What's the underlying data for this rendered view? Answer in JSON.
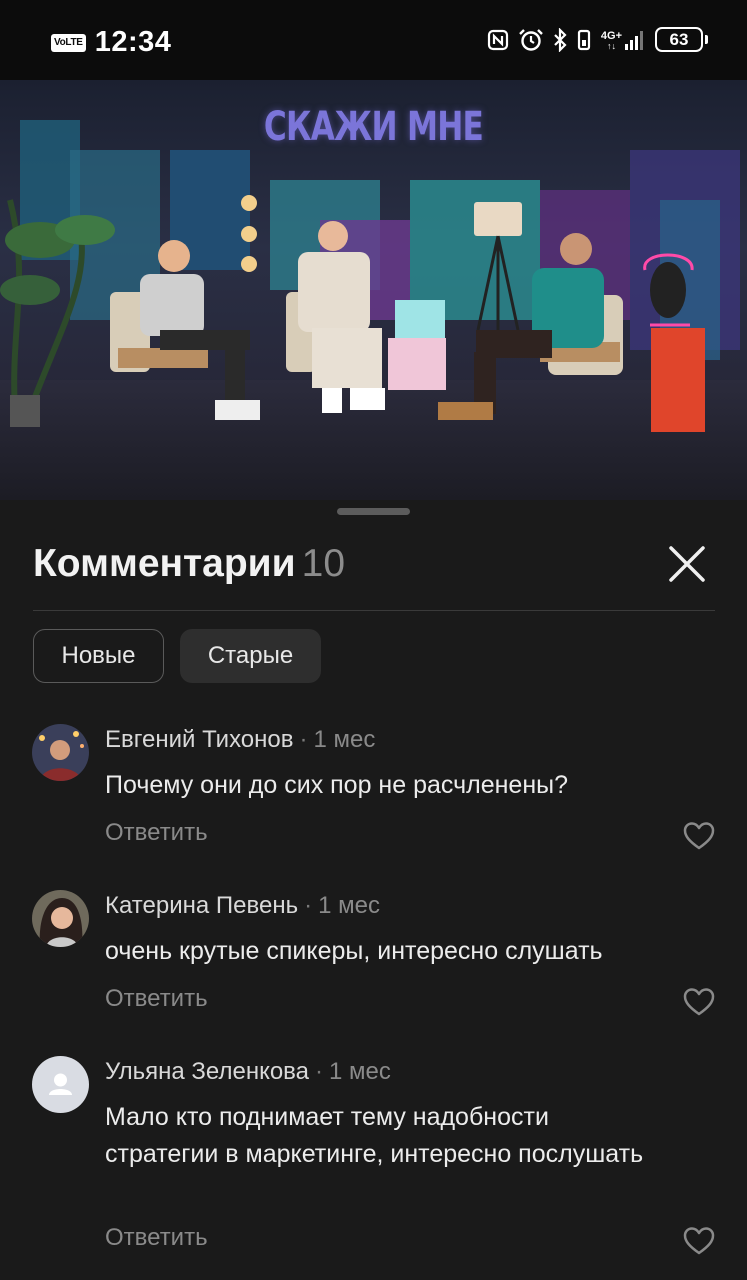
{
  "status_bar": {
    "volte": "VoLTE",
    "time": "12:34",
    "network_top": "4G+",
    "network_bottom": "↑↓",
    "battery": "63"
  },
  "video": {
    "title_overlay": "СКАЖИ МНЕ"
  },
  "comments_sheet": {
    "title": "Комментарии",
    "count": "10",
    "sort": {
      "new_label": "Новые",
      "old_label": "Старые",
      "selected": "old"
    },
    "comments": [
      {
        "author": "Евгений Тихонов",
        "separator": "·",
        "time": "1 мес",
        "text": "Почему они до сих пор не расчленены?",
        "reply_label": "Ответить",
        "avatar": "photo"
      },
      {
        "author": "Катерина Певень",
        "separator": "·",
        "time": "1 мес",
        "text": "очень крутые спикеры, интересно слушать",
        "reply_label": "Ответить",
        "avatar": "photo"
      },
      {
        "author": "Ульяна Зеленкова",
        "separator": "·",
        "time": "1 мес",
        "text": "Мало кто поднимает тему надобности стратегии в маркетинге,  интересно послушать",
        "reply_label": "Ответить",
        "avatar": "default-user-icon"
      }
    ]
  },
  "colors": {
    "background": "#1a1a1a",
    "status_bar": "#0c0c0c",
    "title_overlay": "#7b75d9",
    "muted_text": "#8a8a8a"
  }
}
